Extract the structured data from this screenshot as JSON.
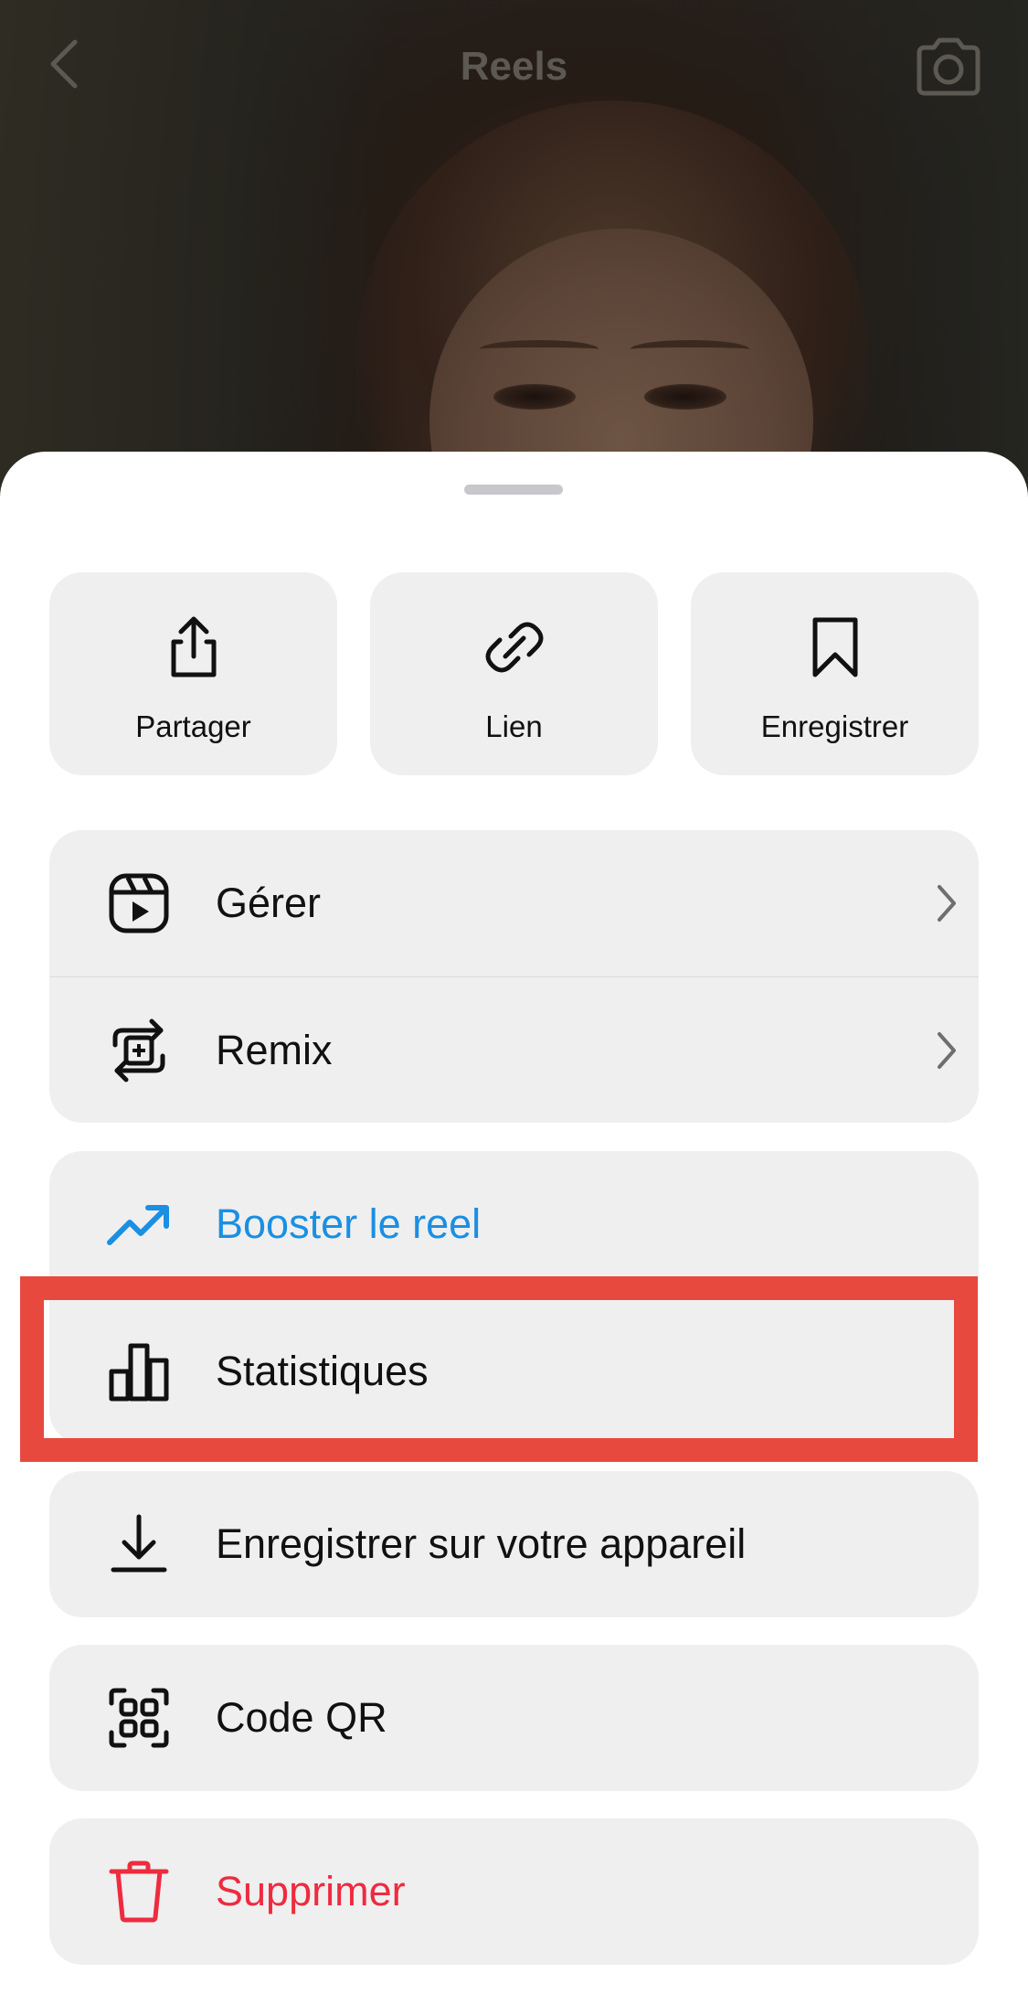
{
  "header": {
    "title": "Reels",
    "back_icon": "chevron-left-icon",
    "camera_icon": "camera-icon"
  },
  "quick_actions": [
    {
      "label": "Partager",
      "icon": "share-icon"
    },
    {
      "label": "Lien",
      "icon": "link-icon"
    },
    {
      "label": "Enregistrer",
      "icon": "bookmark-icon"
    }
  ],
  "menu": {
    "manage": {
      "label": "Gérer",
      "icon": "reels-icon"
    },
    "remix": {
      "label": "Remix",
      "icon": "remix-icon"
    },
    "boost": {
      "label": "Booster le reel",
      "icon": "trending-up-icon"
    },
    "insights": {
      "label": "Statistiques",
      "icon": "bar-chart-icon"
    },
    "download": {
      "label": "Enregistrer sur votre appareil",
      "icon": "download-icon"
    },
    "qr": {
      "label": "Code QR",
      "icon": "qr-code-icon"
    },
    "delete": {
      "label": "Supprimer",
      "icon": "trash-icon"
    }
  },
  "colors": {
    "accent_blue": "#1a8fe3",
    "danger_red": "#ee2b3f",
    "highlight": "#e8493f",
    "row_bg": "#efefef"
  }
}
